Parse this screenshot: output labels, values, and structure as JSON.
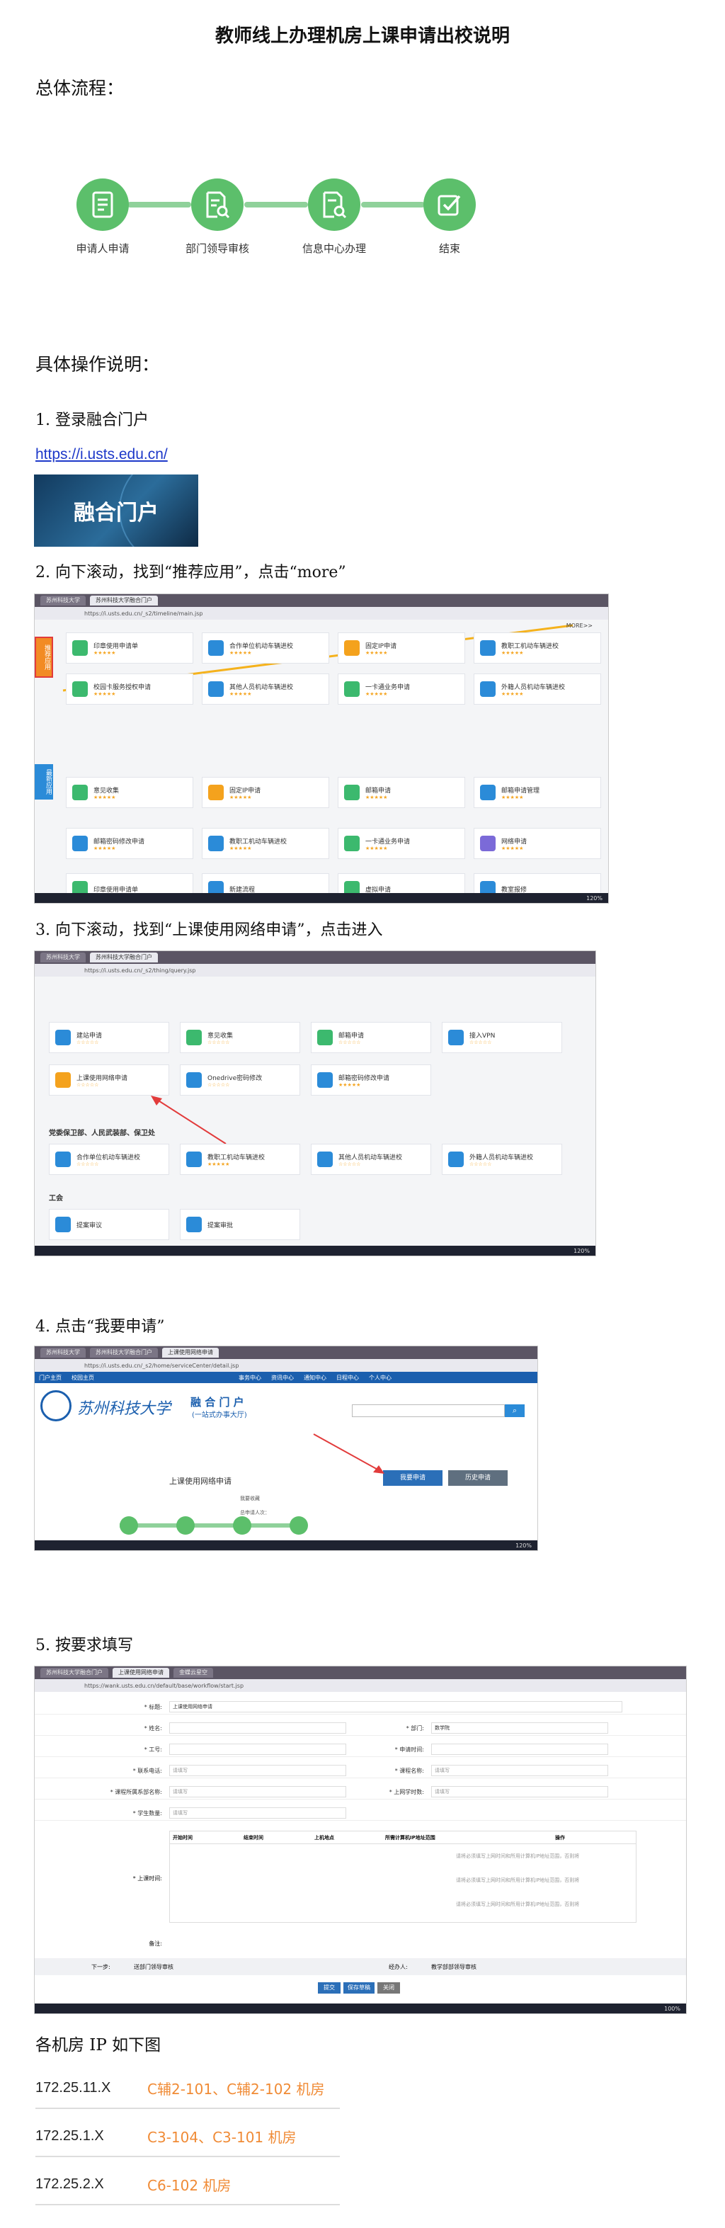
{
  "title": "教师线上办理机房上课申请出校说明",
  "overall_heading": "总体流程：",
  "flow": [
    {
      "label": "申请人申请",
      "icon": "document-icon"
    },
    {
      "label": "部门领导审核",
      "icon": "review-icon"
    },
    {
      "label": "信息中心办理",
      "icon": "process-icon"
    },
    {
      "label": "结束",
      "icon": "check-icon"
    }
  ],
  "detail_heading": "具体操作说明：",
  "steps": {
    "s1": "1. 登录融合门户",
    "s2": "2. 向下滚动，找到“推荐应用”，点击“more”",
    "s3": "3. 向下滚动，找到“上课使用网络申请”，点击进入",
    "s4": "4. 点击“我要申请”",
    "s5": "5. 按要求填写"
  },
  "portal_link": "https://i.usts.edu.cn/",
  "portal_banner": "融合门户",
  "shot2": {
    "tabs": [
      "苏州科技大学",
      "苏州科技大学融合门户"
    ],
    "address": "https://i.usts.edu.cn/_s2/timeline/main.jsp",
    "side_tags": [
      "推荐应用",
      "最新应用"
    ],
    "more": "MORE>>",
    "cards": [
      "印章使用申请单",
      "合作单位机动车辆进校",
      "固定IP申请",
      "教职工机动车辆进校",
      "校园卡服务授权申请",
      "其他人员机动车辆进校",
      "一卡通业务申请",
      "外籍人员机动车辆进校",
      "意见收集",
      "固定IP申请",
      "邮箱申请",
      "邮箱申请管理",
      "邮箱密码修改申请",
      "教职工机动车辆进校",
      "一卡通业务申请",
      "网络申请",
      "印章使用申请单",
      "新建流程",
      "虚拟申请",
      "教室报修"
    ],
    "zoom": "120%"
  },
  "shot3": {
    "tabs": [
      "苏州科技大学",
      "苏州科技大学融合门户"
    ],
    "address": "https://i.usts.edu.cn/_s2/thing/query.jsp",
    "cards": [
      "建站申请",
      "意见收集",
      "邮箱申请",
      "接入VPN",
      "上课使用网络申请",
      "Onedrive密码修改",
      "邮箱密码修改申请"
    ],
    "group1": "党委保卫部、人民武装部、保卫处",
    "group1_cards": [
      "合作单位机动车辆进校",
      "教职工机动车辆进校",
      "其他人员机动车辆进校",
      "外籍人员机动车辆进校"
    ],
    "group2": "工会",
    "group2_cards": [
      "提案审议",
      "提案审批"
    ],
    "zoom": "120%"
  },
  "shot4": {
    "tabs": [
      "苏州科技大学",
      "苏州科技大学融合门户",
      "上课使用网络申请"
    ],
    "address": "https://i.usts.edu.cn/_s2/home/serviceCenter/detail.jsp",
    "nav": [
      "门户主页",
      "校园主页",
      "事务中心",
      "资讯中心",
      "通知中心",
      "日程中心",
      "个人中心"
    ],
    "logo_text": "苏州科技大学",
    "portal_title": "融 合 门 户",
    "portal_sub": "(一站式办事大厅)",
    "service_name": "上课使用网络申请",
    "apply_btn": "我要申请",
    "history_btn": "历史申请",
    "favorite": "我要收藏",
    "stats": "总申请人次：",
    "zoom": "120%"
  },
  "shot5": {
    "tabs": [
      "苏州科技大学融合门户",
      "上课使用网络申请",
      "金蝶云星空"
    ],
    "address": "https://wank.usts.edu.cn/default/base/workflow/start.jsp",
    "title_label": "* 标题:",
    "title_value": "上课使用网络申请",
    "fields": [
      {
        "l": "* 姓名:",
        "v": "",
        "r": "* 部门:",
        "rv": "数学院"
      },
      {
        "l": "* 工号:",
        "v": "",
        "r": "* 申请时间:",
        "rv": ""
      },
      {
        "l": "* 联系电话:",
        "v": "请填写",
        "r": "* 课程名称:",
        "rv": "请填写"
      },
      {
        "l": "* 课程所属系部名称:",
        "v": "请填写",
        "r": "* 上网学时数:",
        "rv": "请填写"
      },
      {
        "l": "* 学生数量:",
        "v": "请填写",
        "r": "",
        "rv": ""
      }
    ],
    "time_label": "* 上课时间:",
    "table_cols": [
      "开始时间",
      "结束时间",
      "上机地点",
      "所需计算机IP地址范围",
      "操作"
    ],
    "ip_hint": "请将必须填写上网时间和所用计算机IP地址范围，否则将",
    "remark": "备注:",
    "next_step": "下一步:",
    "next_value": "送部门领导审核",
    "handler": "经办人:",
    "handler_value": "教学部部领导审核",
    "submit": "提交",
    "save": "保存草稿",
    "close": "关闭",
    "zoom": "100%"
  },
  "ip_heading": "各机房 IP 如下图",
  "ip_rows": [
    {
      "ip": "172.25.11.X",
      "room": "C辅2-101、C辅2-102 机房"
    },
    {
      "ip": "172.25.1.X",
      "room": "C3-104、C3-101 机房"
    },
    {
      "ip": "172.25.2.X",
      "room": "C6-102 机房"
    }
  ],
  "colors": {
    "flow_green": "#5cbf6b",
    "accent_blue": "#2b8bd8",
    "room_orange": "#f08b36"
  }
}
